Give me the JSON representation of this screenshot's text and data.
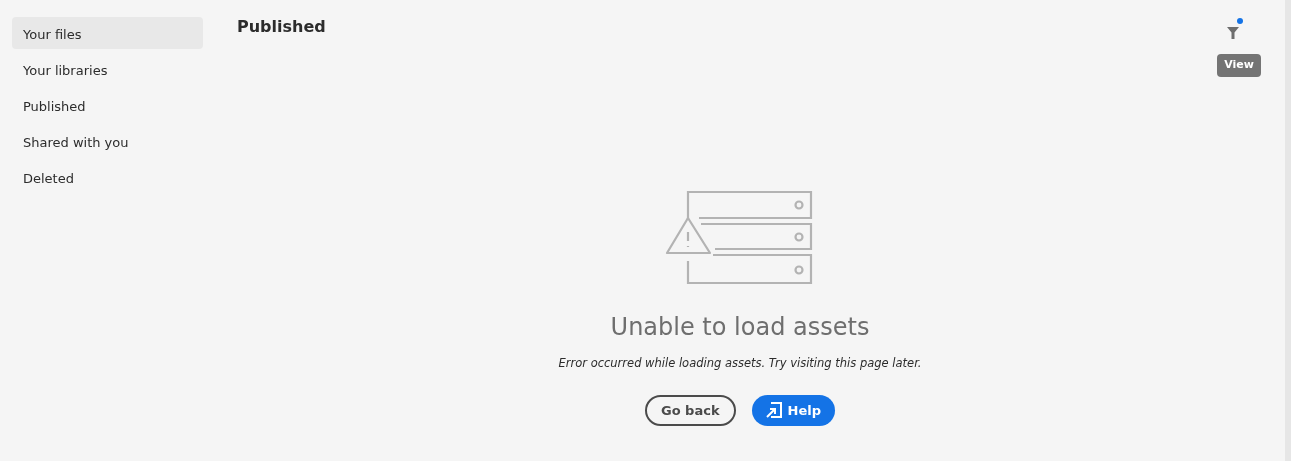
{
  "sidebar": {
    "items": [
      {
        "label": "Your files",
        "selected": true
      },
      {
        "label": "Your libraries",
        "selected": false
      },
      {
        "label": "Published",
        "selected": false
      },
      {
        "label": "Shared with you",
        "selected": false
      },
      {
        "label": "Deleted",
        "selected": false
      }
    ]
  },
  "header": {
    "title": "Published",
    "filter": {
      "active": true,
      "tooltip": "View"
    }
  },
  "empty_state": {
    "heading": "Unable to load assets",
    "message": "Error occurred while loading assets. Try visiting this page later.",
    "buttons": [
      {
        "label": "Go back",
        "kind": "outline"
      },
      {
        "label": "Help",
        "kind": "primary"
      }
    ]
  }
}
